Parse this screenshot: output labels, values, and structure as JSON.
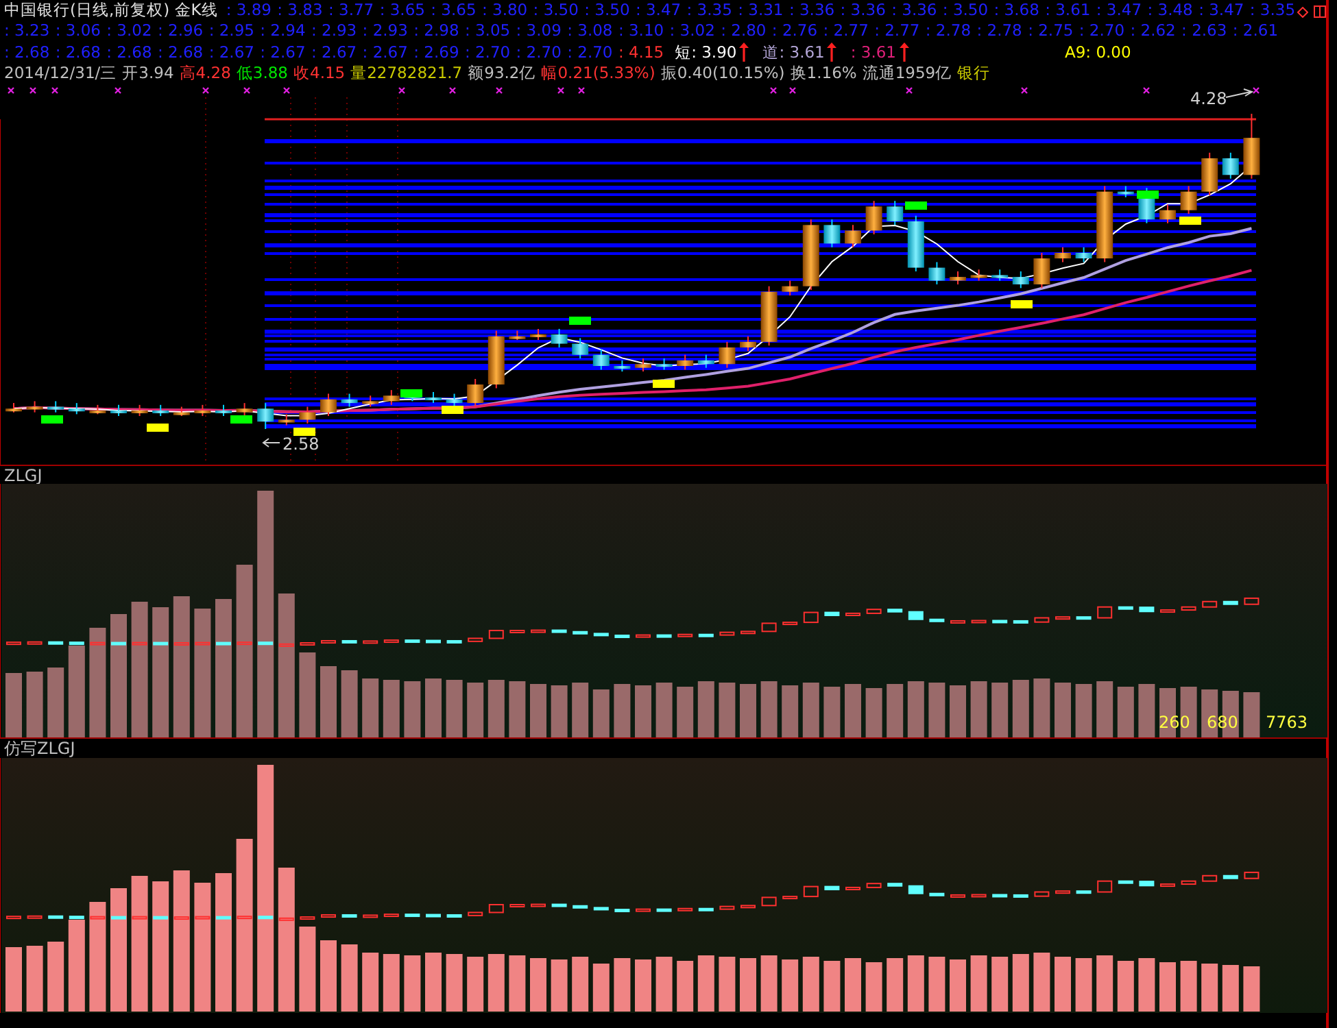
{
  "title": "中国银行(日线,前复权)",
  "indicator_name": "金K线",
  "ma_rows": [
    {
      "values": [
        ": 3.89",
        ": 3.83",
        ": 3.77",
        ": 3.65",
        ": 3.65",
        ": 3.80",
        ": 3.50",
        ": 3.50",
        ": 3.47",
        ": 3.35",
        ": 3.31",
        ": 3.36",
        ": 3.36",
        ": 3.36",
        ": 3.50",
        ": 3.68",
        ": 3.61",
        ": 3.47",
        ": 3.48",
        ": 3.47",
        ": 3.35"
      ]
    },
    {
      "values": [
        ": 3.23",
        ": 3.06",
        ": 3.02",
        ": 2.96",
        ": 2.95",
        ": 2.94",
        ": 2.93",
        ": 2.93",
        ": 2.98",
        ": 3.05",
        ": 3.09",
        ": 3.08",
        ": 3.10",
        ": 3.02",
        ": 2.80",
        ": 2.76",
        ": 2.77",
        ": 2.77",
        ": 2.78",
        ": 2.78",
        ": 2.75",
        ": 2.70",
        ": 2.62",
        ": 2.63",
        ": 2.61"
      ]
    }
  ],
  "signal_row": {
    "values": [
      ": 2.68",
      ": 2.68",
      ": 2.68",
      ": 2.68",
      ": 2.67",
      ": 2.67",
      ": 2.67",
      ": 2.67",
      ": 2.69",
      ": 2.70",
      ": 2.70",
      ": 2.70"
    ],
    "current": ": 4.15",
    "signals": [
      {
        "text": "短: 3.90",
        "color": "#ffffff"
      },
      {
        "text": "道: 3.61",
        "color": "#b4a6d8"
      },
      {
        "text": ": 3.61",
        "color": "#e0207a"
      }
    ],
    "a9": "A9: 0.00"
  },
  "info_bar": [
    {
      "text": "2014/12/31/三",
      "color": "#c0c0c0"
    },
    {
      "text": "开3.94",
      "color": "#c0c0c0"
    },
    {
      "text": "高4.28",
      "color": "#ff3232"
    },
    {
      "text": "低3.88",
      "color": "#00e600"
    },
    {
      "text": "收4.15",
      "color": "#ff3232"
    },
    {
      "text": "量22782821.7",
      "color": "#c8c800"
    },
    {
      "text": "额93.2亿",
      "color": "#c0c0c0"
    },
    {
      "text": "幅0.21(5.33%)",
      "color": "#ff3232"
    },
    {
      "text": "振0.40(10.15%)",
      "color": "#c0c0c0"
    },
    {
      "text": "换1.16%",
      "color": "#c0c0c0"
    },
    {
      "text": "流通1959亿",
      "color": "#c0c0c0"
    },
    {
      "text": "银行",
      "color": "#c8c800"
    }
  ],
  "high_label": "4.28",
  "low_label": "2.58",
  "panels": [
    {
      "title": "ZLGJ",
      "readings": [
        "260",
        "680",
        "7763"
      ]
    },
    {
      "title": "仿写ZLGJ"
    }
  ]
}
